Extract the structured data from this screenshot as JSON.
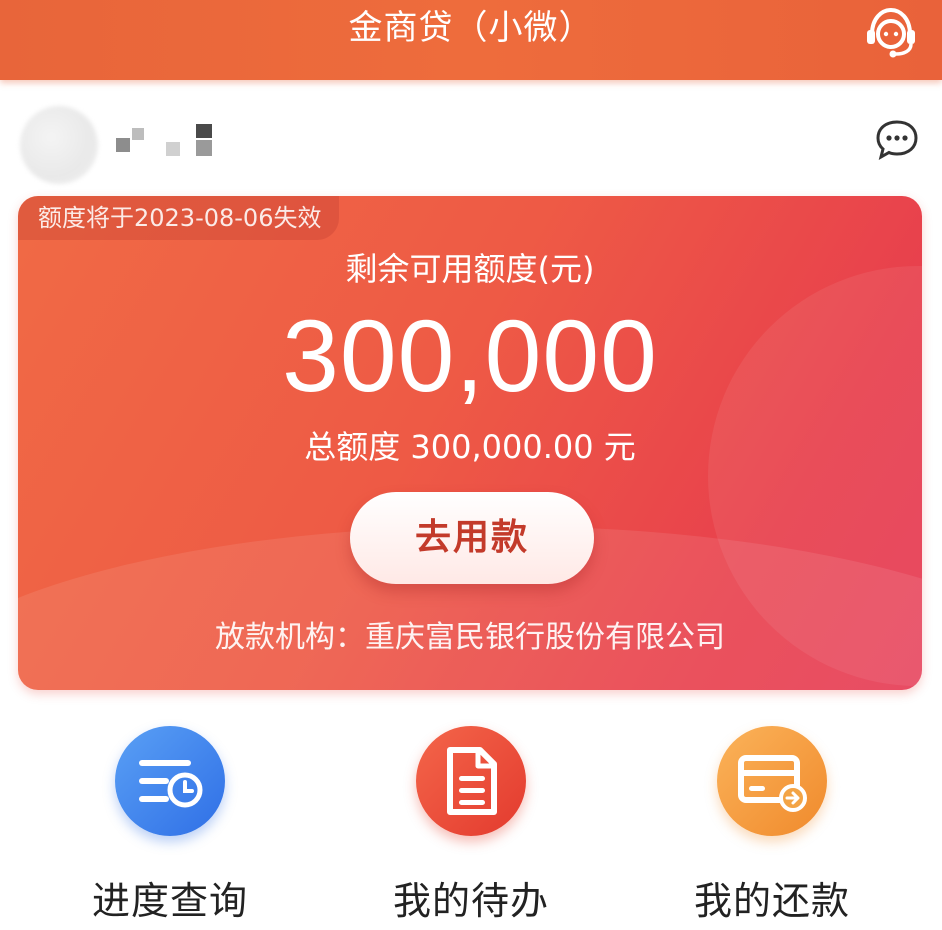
{
  "header": {
    "title": "金商贷（小微）",
    "support_icon": "customer-service-headset-icon"
  },
  "user": {
    "name_masked": true,
    "chat_icon": "chat-bubble-icon"
  },
  "card": {
    "expiry_notice": "额度将于2023-08-06失效",
    "balance_label": "剩余可用额度(元)",
    "balance_amount": "300,000",
    "total_line": "总额度 300,000.00 元",
    "withdraw_button": "去用款",
    "lender_line": "放款机构：重庆富民银行股份有限公司",
    "colors": {
      "start": "#f06a45",
      "end": "#e63b55"
    }
  },
  "actions": [
    {
      "label": "进度查询",
      "icon": "progress-list-clock-icon",
      "color": "#2f6fe6"
    },
    {
      "label": "我的待办",
      "icon": "document-icon",
      "color": "#e33a2e"
    },
    {
      "label": "我的还款",
      "icon": "card-repay-icon",
      "color": "#f08a2c"
    }
  ]
}
